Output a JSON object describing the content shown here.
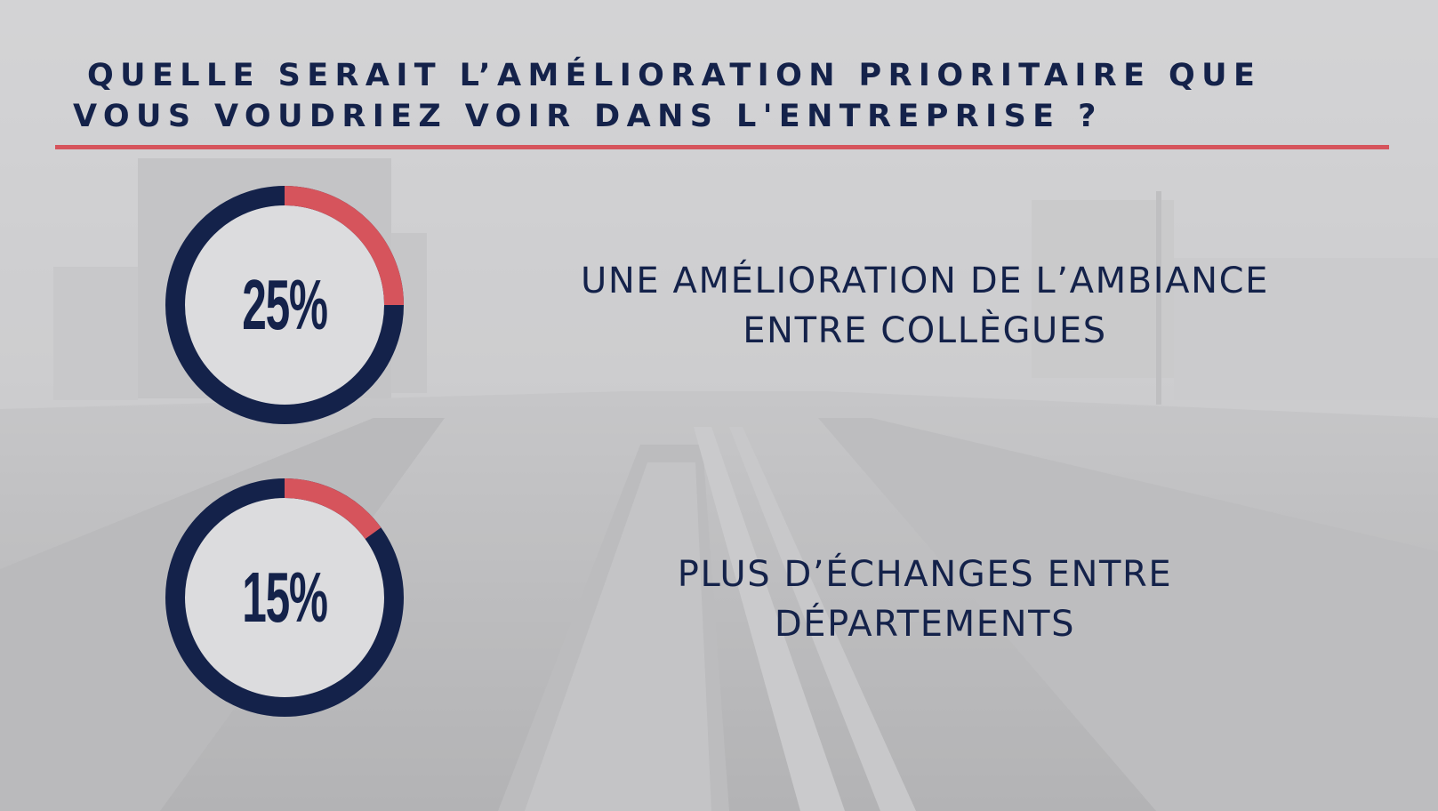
{
  "title": {
    "line1": "Quelle serait l’amélioration prioritaire que",
    "line2": "vous voudriez voir dans l'entreprise ?"
  },
  "colors": {
    "navy": "#14224a",
    "accent": "#d6545c",
    "donut_inner": "#dcdcde"
  },
  "chart_data": [
    {
      "type": "pie",
      "values": [
        25,
        75
      ],
      "value_label": "25%",
      "label_lines": [
        "UNE AMÉLIORATION DE L’AMBIANCE",
        "ENTRE COLLÈGUES"
      ]
    },
    {
      "type": "pie",
      "values": [
        15,
        85
      ],
      "value_label": "15%",
      "label_lines": [
        "PLUS D’ÉCHANGES ENTRE",
        "DÉPARTEMENTS"
      ]
    }
  ]
}
